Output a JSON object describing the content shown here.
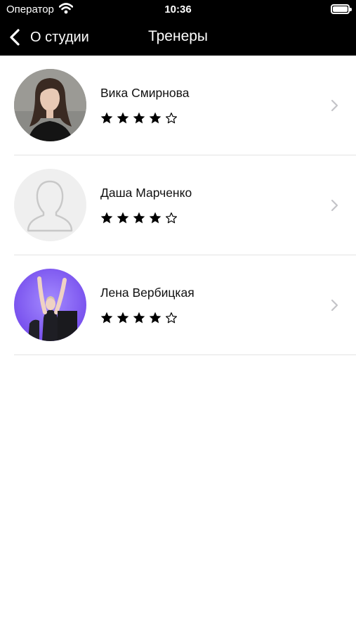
{
  "status_bar": {
    "carrier": "Оператор",
    "time": "10:36",
    "icons": [
      "wifi-icon",
      "battery-icon"
    ]
  },
  "navbar": {
    "back_label": "О студии",
    "title": "Тренеры"
  },
  "trainers": [
    {
      "name": "Вика Смирнова",
      "rating": 4,
      "max_rating": 5,
      "avatar": "photo"
    },
    {
      "name": "Даша Марченко",
      "rating": 4,
      "max_rating": 5,
      "avatar": "placeholder"
    },
    {
      "name": "Лена Вербицкая",
      "rating": 4,
      "max_rating": 5,
      "avatar": "photo"
    }
  ],
  "colors": {
    "header_bg": "#000000",
    "header_text": "#ffffff",
    "star": "#000000",
    "chevron": "#c4c4c8",
    "divider": "#e3e3e3"
  }
}
